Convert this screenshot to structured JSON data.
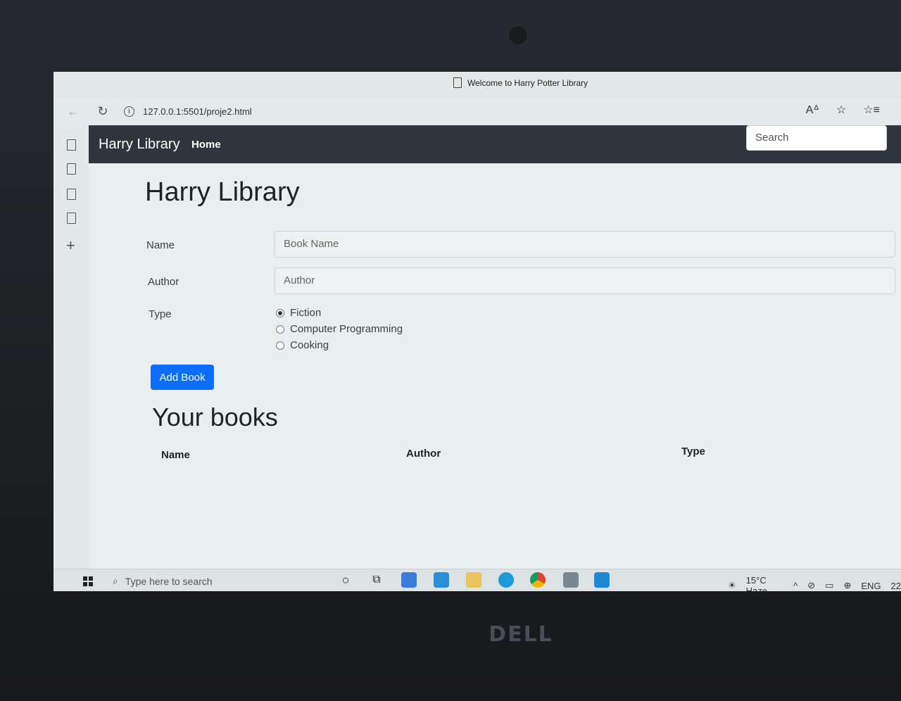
{
  "browser": {
    "tab_title": "Welcome to Harry Potter Library",
    "url": "127.0.0.1:5501/proje2.html",
    "read_aloud": "A̅"
  },
  "navbar": {
    "brand": "Harry Library",
    "home": "Home",
    "search_placeholder": "Search"
  },
  "form": {
    "title": "Harry Library",
    "name_label": "Name",
    "name_placeholder": "Book Name",
    "author_label": "Author",
    "author_placeholder": "Author",
    "type_label": "Type",
    "types": [
      "Fiction",
      "Computer Programming",
      "Cooking"
    ],
    "selected_type": "Fiction",
    "submit": "Add Book"
  },
  "books": {
    "title": "Your books",
    "headers": [
      "Name",
      "Author",
      "Type"
    ],
    "rows": []
  },
  "taskbar": {
    "search_placeholder": "Type here to search",
    "weather": "15°C  Haze",
    "language": "ENG",
    "time_partial": "22"
  },
  "hardware": {
    "brand": "DELL"
  }
}
